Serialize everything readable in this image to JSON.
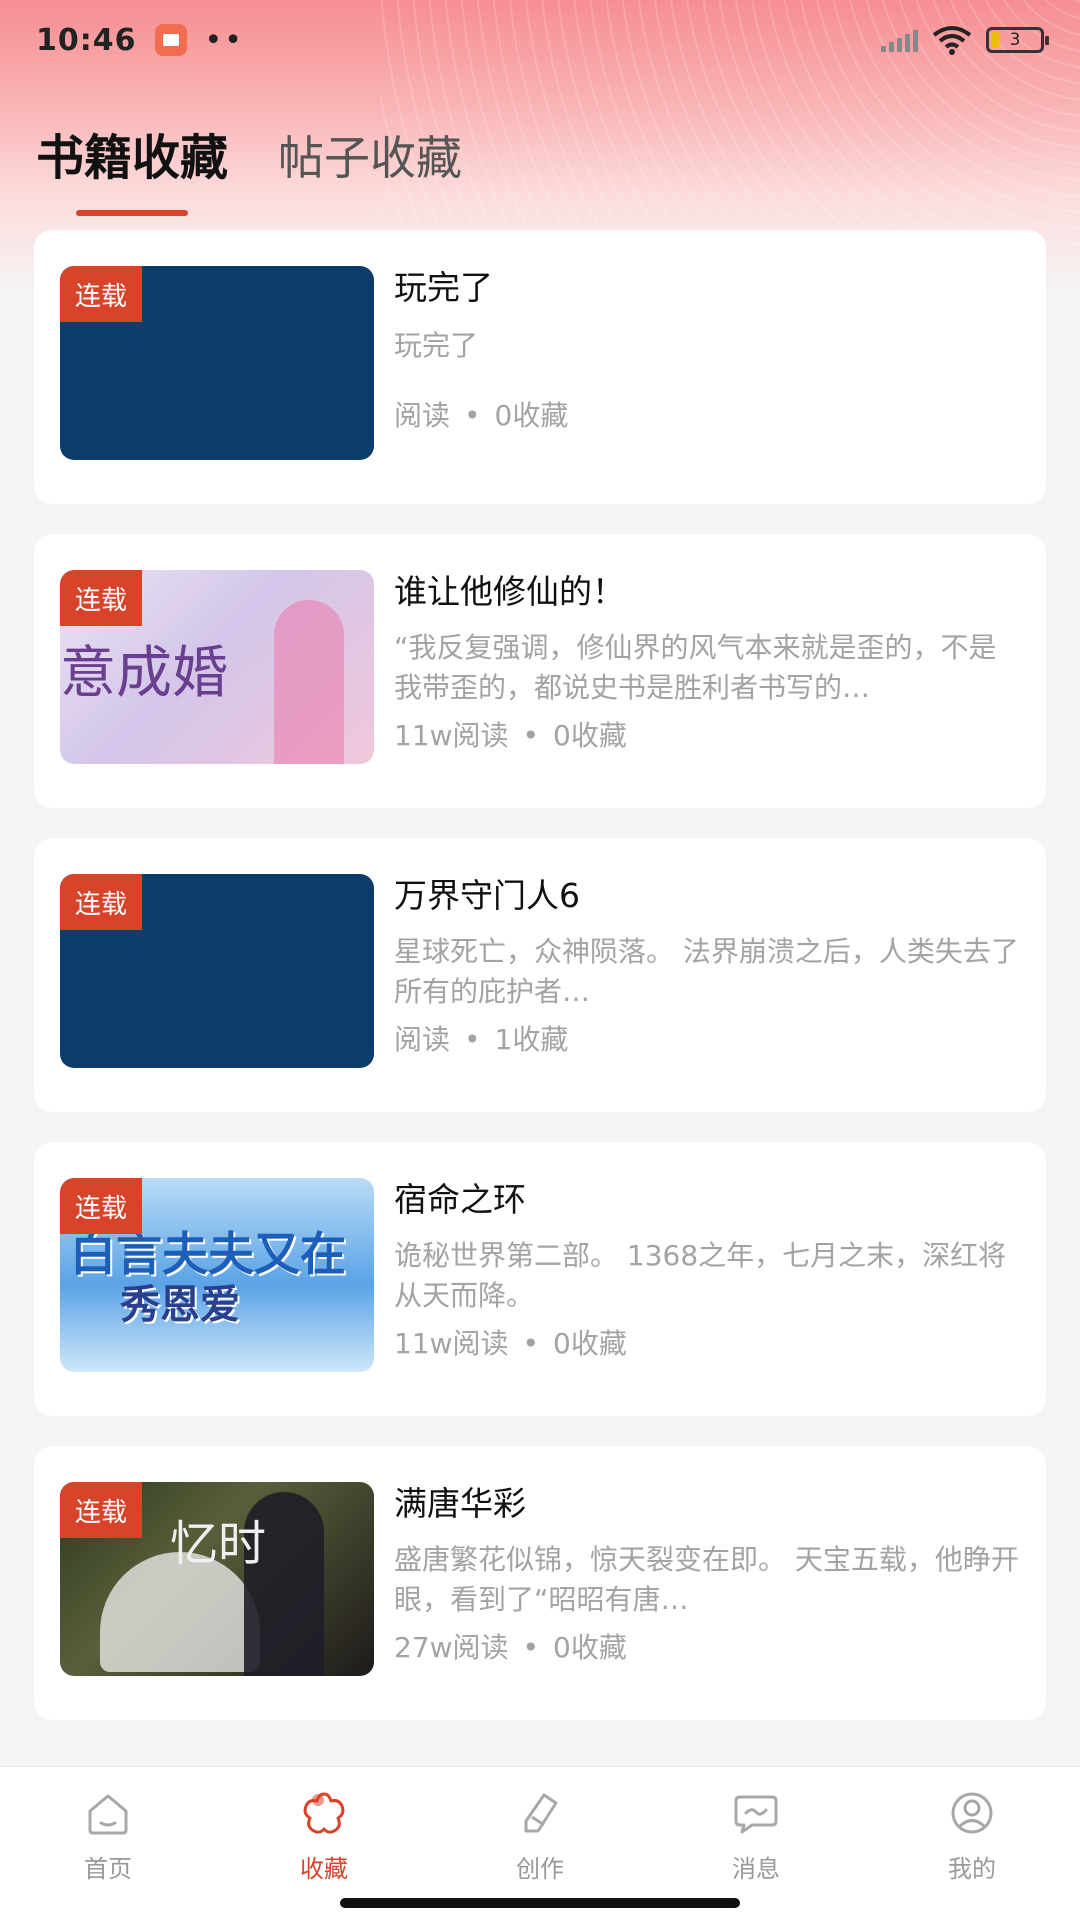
{
  "status_bar": {
    "time": "10:46",
    "dots": "••",
    "battery_level": "3"
  },
  "tabs": [
    {
      "label": "书籍收藏",
      "active": true
    },
    {
      "label": "帖子收藏",
      "active": false
    }
  ],
  "books": [
    {
      "badge": "连载",
      "title": "玩完了",
      "description": "玩完了",
      "reads": "阅读",
      "favorites": "0收藏",
      "cover_text": ""
    },
    {
      "badge": "连载",
      "title": "谁让他修仙的！",
      "description": "“我反复强调，修仙界的风气本来就是歪的，不是我带歪的，都说史书是胜利者书写的…",
      "reads": "11w阅读",
      "favorites": "0收藏",
      "cover_text": "意成婚"
    },
    {
      "badge": "连载",
      "title": "万界守门人6",
      "description": "星球死亡，众神陨落。 法界崩溃之后，人类失去了所有的庇护者…",
      "reads": "阅读",
      "favorites": "1收藏",
      "cover_text": ""
    },
    {
      "badge": "连载",
      "title": "宿命之环",
      "description": "诡秘世界第二部。 1368之年，七月之末，深红将从天而降。",
      "reads": "11w阅读",
      "favorites": "0收藏",
      "cover_text": "白言夫夫又在",
      "cover_text_2": "秀恩爱"
    },
    {
      "badge": "连载",
      "title": "满唐华彩",
      "description": "盛唐繁花似锦，惊天裂变在即。 天宝五载，他睁开眼，看到了“昭昭有唐…",
      "reads": "27w阅读",
      "favorites": "0收藏",
      "cover_text": "忆时"
    }
  ],
  "meta_separator": "•",
  "bottom_nav": [
    {
      "label": "首页",
      "icon": "home-icon",
      "active": false
    },
    {
      "label": "收藏",
      "icon": "favorites-icon",
      "active": true
    },
    {
      "label": "创作",
      "icon": "pen-icon",
      "active": false
    },
    {
      "label": "消息",
      "icon": "message-icon",
      "active": false
    },
    {
      "label": "我的",
      "icon": "profile-icon",
      "active": false
    }
  ],
  "colors": {
    "accent": "#d9432a",
    "inactive": "#999999"
  }
}
